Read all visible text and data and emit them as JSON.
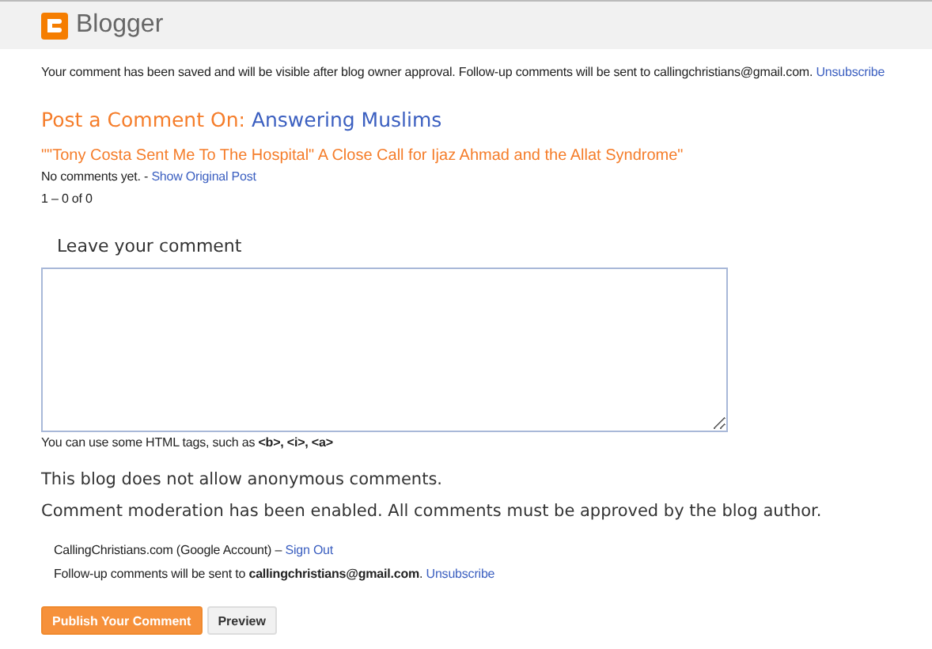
{
  "header": {
    "brand": "Blogger"
  },
  "notice": {
    "text": "Your comment has been saved and will be visible after blog owner approval. Follow-up comments will be sent to callingchristians@gmail.com.",
    "link": "Unsubscribe"
  },
  "heading": {
    "prefix": "Post a Comment On:",
    "blog": "Answering Muslims"
  },
  "post": {
    "title": "\"\"Tony Costa Sent Me To The Hospital\" A Close Call for Ijaz Ahmad and the Allat Syndrome\"",
    "status": "No comments yet. -",
    "link": "Show Original Post",
    "count": "1 – 0 of 0"
  },
  "form": {
    "label": "Leave your comment",
    "hint": "You can use some HTML tags, such as **<b>, <i>, <a>**"
  },
  "messages": [
    "This blog does not allow anonymous comments.",
    "Comment moderation has been enabled. All comments must be approved by the blog author."
  ],
  "account": {
    "name": "CallingChristians.com (Google Account) –",
    "signout": "Sign Out",
    "followup": "Follow-up comments will be sent to **callingchristians@gmail.com**.",
    "unsubscribe": "Unsubscribe"
  },
  "buttons": [
    {
      "label": "Publish Your Comment",
      "kind": "primary"
    },
    {
      "label": "Preview",
      "kind": "secondary"
    }
  ]
}
